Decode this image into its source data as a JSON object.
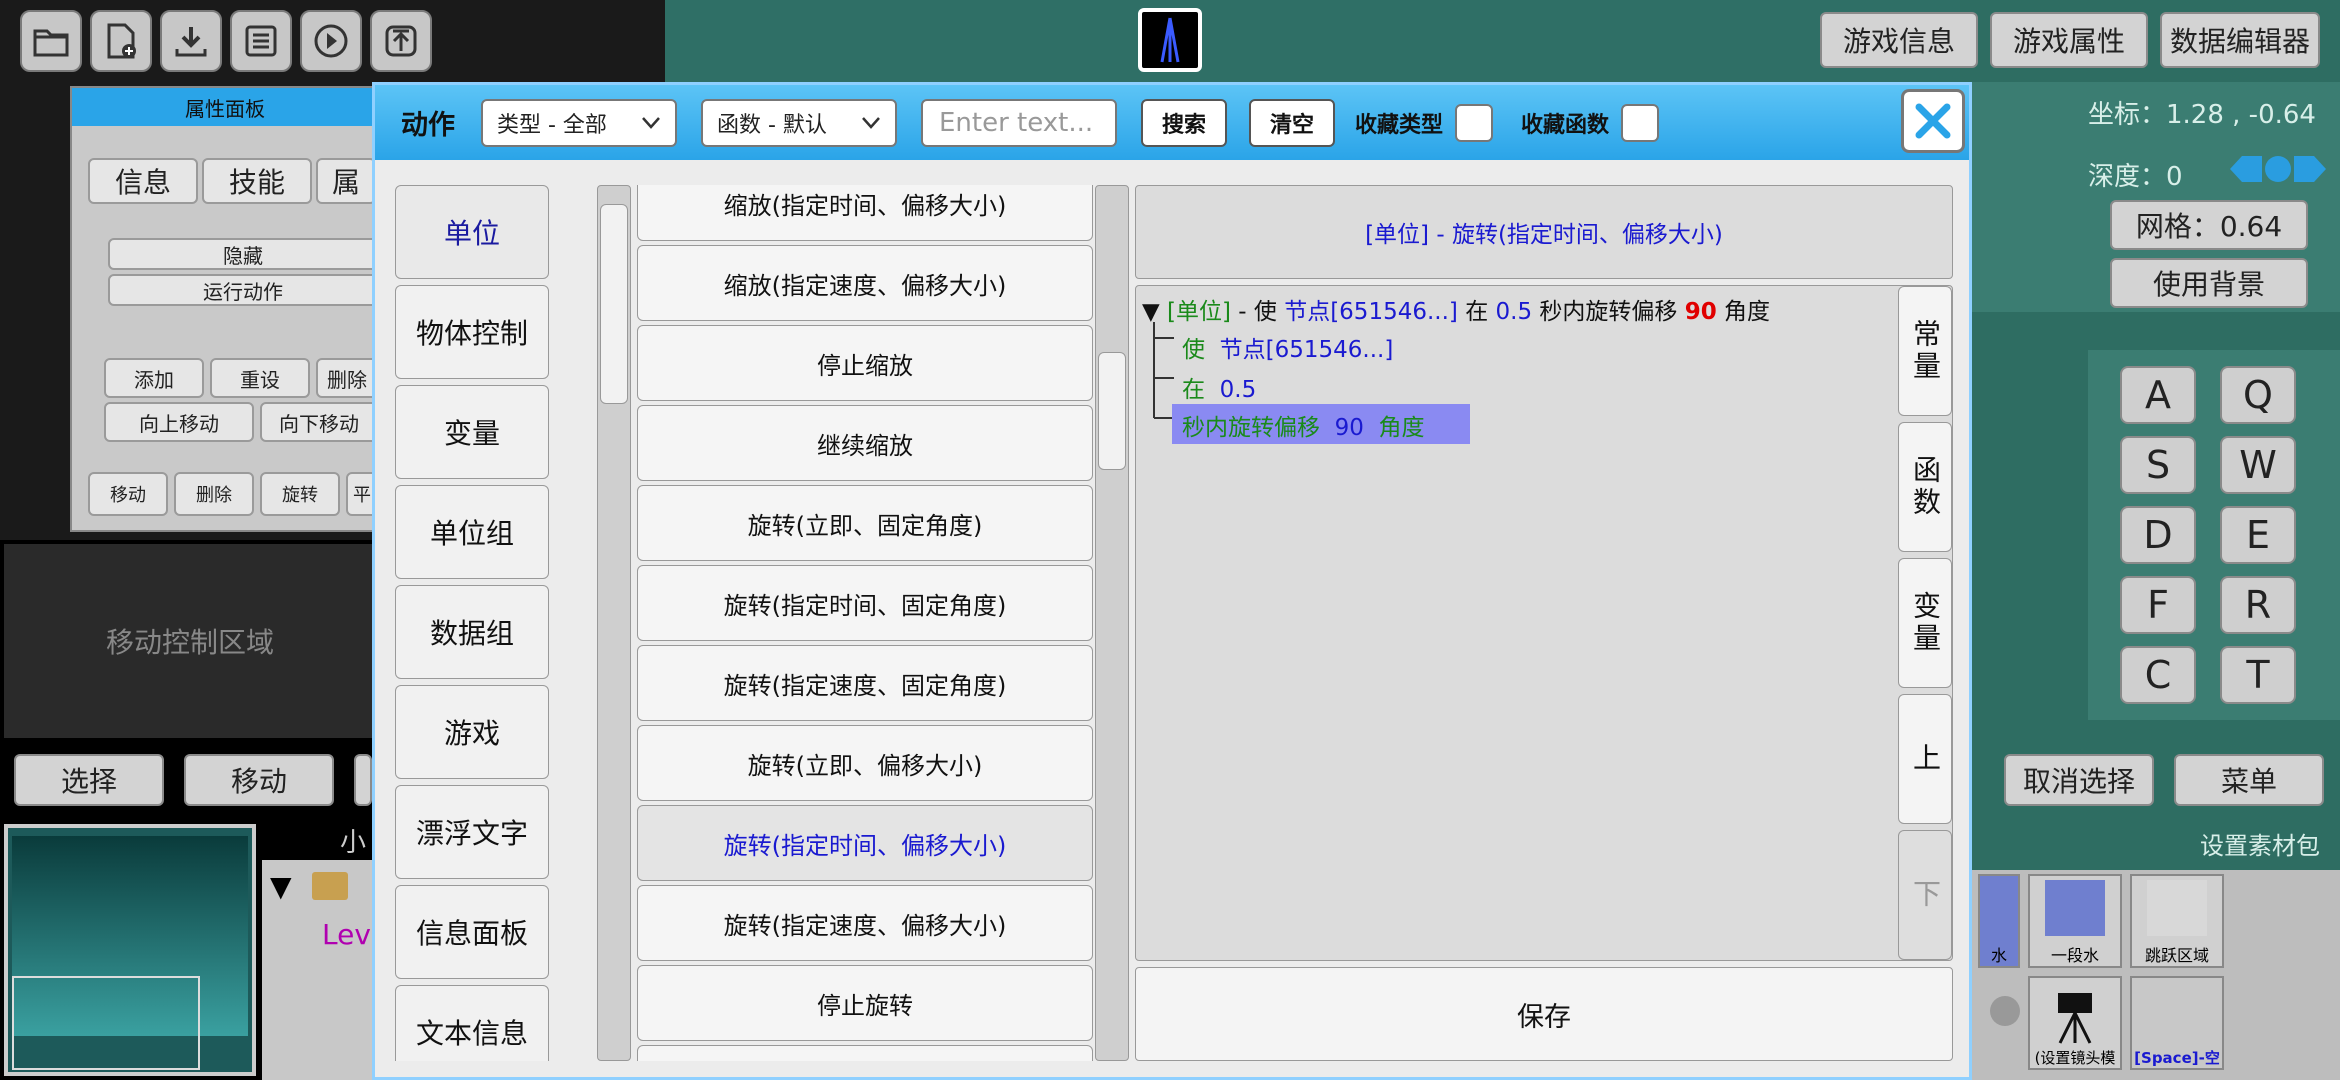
{
  "toolbar": {
    "icons": [
      "folder-icon",
      "new-file-icon",
      "download-icon",
      "save-icon",
      "play-icon",
      "upload-icon"
    ]
  },
  "top_right_buttons": [
    "游戏信息",
    "游戏属性",
    "数据编辑器"
  ],
  "right_panel": {
    "coord": "坐标：1.28 , -0.64",
    "depth_label": "深度：",
    "depth_value": "0",
    "grid": "网格：0.64",
    "use_bg": "使用背景",
    "keys": [
      "A",
      "Q",
      "S",
      "W",
      "D",
      "E",
      "F",
      "R",
      "C",
      "T"
    ]
  },
  "props_panel": {
    "title": "属性面板",
    "tabs": [
      "信息",
      "技能",
      "属"
    ],
    "hide": "隐藏",
    "run_action": "运行动作",
    "row1": [
      "添加",
      "重设",
      "删除"
    ],
    "row2": [
      "向上移动",
      "向下移动"
    ],
    "row3": [
      "移动",
      "删除",
      "旋转",
      "平"
    ]
  },
  "move_area": "移动控制区域",
  "bottom_left_buttons": [
    "选择",
    "移动"
  ],
  "bottom_right_buttons": [
    "取消选择",
    "菜单"
  ],
  "asset_pack": {
    "label": "设置素材包",
    "items": [
      "水",
      "一段水",
      "跳跃区域",
      "(设置镜头模",
      "[Space]-空"
    ]
  },
  "hierarchy": {
    "partial_label": "小",
    "item": "Lev"
  },
  "dialog": {
    "title": "动作",
    "type_select": "类型 - 全部",
    "func_select": "函数 - 默认",
    "search_placeholder": "Enter text...",
    "search_btn": "搜索",
    "clear_btn": "清空",
    "fav_type": "收藏类型",
    "fav_func": "收藏函数",
    "categories": [
      "单位",
      "物体控制",
      "变量",
      "单位组",
      "数据组",
      "游戏",
      "漂浮文字",
      "信息面板",
      "文本信息"
    ],
    "functions": [
      "缩放(指定时间、偏移大小)",
      "缩放(指定速度、偏移大小)",
      "停止缩放",
      "继续缩放",
      "旋转(立即、固定角度)",
      "旋转(指定时间、固定角度)",
      "旋转(指定速度、固定角度)",
      "旋转(立即、偏移大小)",
      "旋转(指定时间、偏移大小)",
      "旋转(指定速度、偏移大小)",
      "停止旋转"
    ],
    "header_text": "[单位] - 旋转(指定时间、偏移大小)",
    "tree": {
      "root": {
        "tag": "[单位]",
        "dash": " - 使 ",
        "node": "节点[651546...]",
        "at": " 在 ",
        "time": "0.5",
        "mid": " 秒内旋转偏移 ",
        "angle": "90",
        "unit": " 角度"
      },
      "c1": {
        "a": "使",
        "b": "节点[651546...]"
      },
      "c2": {
        "a": "在",
        "b": "0.5"
      },
      "c3": {
        "a": "秒内旋转偏移",
        "b": "90",
        "c": "角度"
      }
    },
    "side_tabs": [
      "常量",
      "函数",
      "变量",
      "上",
      "下"
    ],
    "save": "保存"
  }
}
